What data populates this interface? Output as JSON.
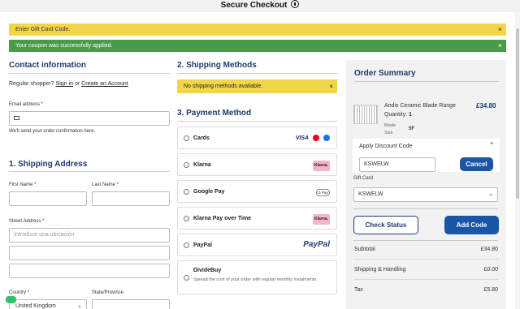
{
  "header": {
    "title": "Secure Checkout",
    "icon": "lock-icon"
  },
  "banners": {
    "gift": "Enter Gift Card Code.",
    "coupon": "Your coupon was successfully applied.",
    "close": "×"
  },
  "contact": {
    "heading": "Contact information",
    "regular_prefix": "Regular shopper?",
    "sign_in": "Sign in",
    "or": "or",
    "create": "Create an Account",
    "email_label": "Email address *",
    "email_note": "We'll send your order confirmation here."
  },
  "shipping_address": {
    "heading": "1. Shipping Address",
    "first_name": "First Name *",
    "last_name": "Last Name *",
    "street": "Street Address *",
    "street_placeholder": "Introduce una ubicación",
    "country": "Country *",
    "country_value": "United Kingdom",
    "state": "State/Province"
  },
  "shipping_methods": {
    "heading": "2. Shipping Methods",
    "notice": "No shipping methods available."
  },
  "payment": {
    "heading": "3. Payment Method",
    "options": [
      {
        "name": "Cards"
      },
      {
        "name": "Klarna",
        "logo": "Klarna."
      },
      {
        "name": "Google Pay",
        "logo": "G Pay"
      },
      {
        "name": "Klarna Pay over Time",
        "logo": "Klarna."
      },
      {
        "name": "PayPal",
        "logo": "PayPal"
      },
      {
        "name": "DivideBuy",
        "desc": "Spread the cost of your order with regular monthly instalments"
      }
    ],
    "visa": "VISA"
  },
  "order_summary": {
    "heading": "Order Summary",
    "product_name": "Andis Ceramic Blade Range",
    "product_price": "£34.80",
    "quantity_label": "Quantity:",
    "quantity": "1",
    "blade_label": "Blade Size",
    "blade_value": "5F",
    "discount_heading": "Apply Discount Code",
    "discount_value": "KSWELW",
    "cancel": "Cancel",
    "gift_label": "Gift Card",
    "gift_value": "KSWELW",
    "check_status": "Check Status",
    "add_code": "Add Code",
    "subtotal_label": "Subtotal",
    "subtotal": "£34.80",
    "shipping_label": "Shipping & Handling",
    "shipping": "£0.00",
    "tax_label": "Tax",
    "tax": "£5.80"
  },
  "colors": {
    "accent": "#1e3a6e",
    "button": "#1b56a6",
    "warning": "#f3d54a",
    "success": "#4a9b49"
  }
}
